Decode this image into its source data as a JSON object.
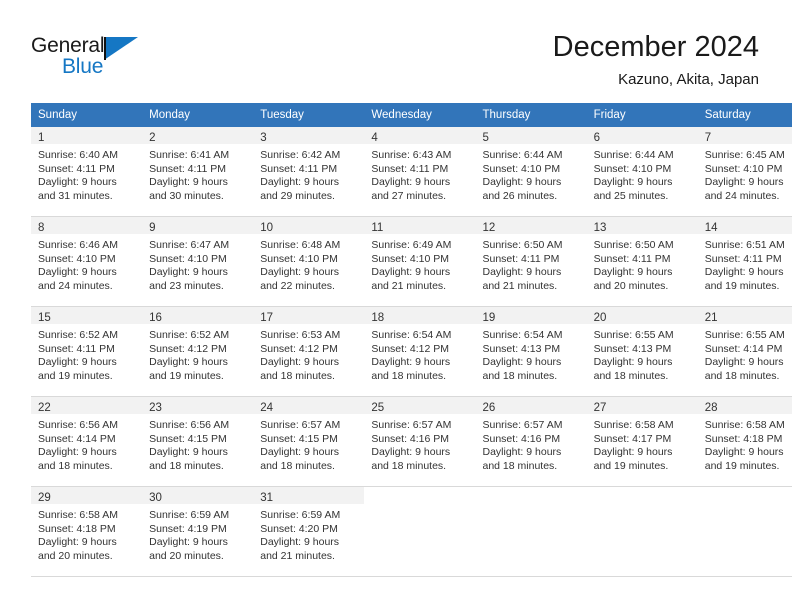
{
  "brand": {
    "word1": "General",
    "word2": "Blue",
    "triangle_color": "#1577c4",
    "text_color": "#1a1a1a"
  },
  "header": {
    "title": "December 2024",
    "subtitle": "Kazuno, Akita, Japan"
  },
  "colors": {
    "header_row_bg": "#3275ba",
    "header_row_text": "#ffffff",
    "daynum_shaded_bg": "#f2f2f2",
    "cell_border": "#d9d9d9",
    "body_text": "#333333"
  },
  "weekday_headers": [
    "Sunday",
    "Monday",
    "Tuesday",
    "Wednesday",
    "Thursday",
    "Friday",
    "Saturday"
  ],
  "weeks": [
    [
      {
        "day": "1",
        "sunrise": "Sunrise: 6:40 AM",
        "sunset": "Sunset: 4:11 PM",
        "daylight1": "Daylight: 9 hours",
        "daylight2": "and 31 minutes."
      },
      {
        "day": "2",
        "sunrise": "Sunrise: 6:41 AM",
        "sunset": "Sunset: 4:11 PM",
        "daylight1": "Daylight: 9 hours",
        "daylight2": "and 30 minutes."
      },
      {
        "day": "3",
        "sunrise": "Sunrise: 6:42 AM",
        "sunset": "Sunset: 4:11 PM",
        "daylight1": "Daylight: 9 hours",
        "daylight2": "and 29 minutes."
      },
      {
        "day": "4",
        "sunrise": "Sunrise: 6:43 AM",
        "sunset": "Sunset: 4:11 PM",
        "daylight1": "Daylight: 9 hours",
        "daylight2": "and 27 minutes."
      },
      {
        "day": "5",
        "sunrise": "Sunrise: 6:44 AM",
        "sunset": "Sunset: 4:10 PM",
        "daylight1": "Daylight: 9 hours",
        "daylight2": "and 26 minutes."
      },
      {
        "day": "6",
        "sunrise": "Sunrise: 6:44 AM",
        "sunset": "Sunset: 4:10 PM",
        "daylight1": "Daylight: 9 hours",
        "daylight2": "and 25 minutes."
      },
      {
        "day": "7",
        "sunrise": "Sunrise: 6:45 AM",
        "sunset": "Sunset: 4:10 PM",
        "daylight1": "Daylight: 9 hours",
        "daylight2": "and 24 minutes."
      }
    ],
    [
      {
        "day": "8",
        "sunrise": "Sunrise: 6:46 AM",
        "sunset": "Sunset: 4:10 PM",
        "daylight1": "Daylight: 9 hours",
        "daylight2": "and 24 minutes."
      },
      {
        "day": "9",
        "sunrise": "Sunrise: 6:47 AM",
        "sunset": "Sunset: 4:10 PM",
        "daylight1": "Daylight: 9 hours",
        "daylight2": "and 23 minutes."
      },
      {
        "day": "10",
        "sunrise": "Sunrise: 6:48 AM",
        "sunset": "Sunset: 4:10 PM",
        "daylight1": "Daylight: 9 hours",
        "daylight2": "and 22 minutes."
      },
      {
        "day": "11",
        "sunrise": "Sunrise: 6:49 AM",
        "sunset": "Sunset: 4:10 PM",
        "daylight1": "Daylight: 9 hours",
        "daylight2": "and 21 minutes."
      },
      {
        "day": "12",
        "sunrise": "Sunrise: 6:50 AM",
        "sunset": "Sunset: 4:11 PM",
        "daylight1": "Daylight: 9 hours",
        "daylight2": "and 21 minutes."
      },
      {
        "day": "13",
        "sunrise": "Sunrise: 6:50 AM",
        "sunset": "Sunset: 4:11 PM",
        "daylight1": "Daylight: 9 hours",
        "daylight2": "and 20 minutes."
      },
      {
        "day": "14",
        "sunrise": "Sunrise: 6:51 AM",
        "sunset": "Sunset: 4:11 PM",
        "daylight1": "Daylight: 9 hours",
        "daylight2": "and 19 minutes."
      }
    ],
    [
      {
        "day": "15",
        "sunrise": "Sunrise: 6:52 AM",
        "sunset": "Sunset: 4:11 PM",
        "daylight1": "Daylight: 9 hours",
        "daylight2": "and 19 minutes."
      },
      {
        "day": "16",
        "sunrise": "Sunrise: 6:52 AM",
        "sunset": "Sunset: 4:12 PM",
        "daylight1": "Daylight: 9 hours",
        "daylight2": "and 19 minutes."
      },
      {
        "day": "17",
        "sunrise": "Sunrise: 6:53 AM",
        "sunset": "Sunset: 4:12 PM",
        "daylight1": "Daylight: 9 hours",
        "daylight2": "and 18 minutes."
      },
      {
        "day": "18",
        "sunrise": "Sunrise: 6:54 AM",
        "sunset": "Sunset: 4:12 PM",
        "daylight1": "Daylight: 9 hours",
        "daylight2": "and 18 minutes."
      },
      {
        "day": "19",
        "sunrise": "Sunrise: 6:54 AM",
        "sunset": "Sunset: 4:13 PM",
        "daylight1": "Daylight: 9 hours",
        "daylight2": "and 18 minutes."
      },
      {
        "day": "20",
        "sunrise": "Sunrise: 6:55 AM",
        "sunset": "Sunset: 4:13 PM",
        "daylight1": "Daylight: 9 hours",
        "daylight2": "and 18 minutes."
      },
      {
        "day": "21",
        "sunrise": "Sunrise: 6:55 AM",
        "sunset": "Sunset: 4:14 PM",
        "daylight1": "Daylight: 9 hours",
        "daylight2": "and 18 minutes."
      }
    ],
    [
      {
        "day": "22",
        "sunrise": "Sunrise: 6:56 AM",
        "sunset": "Sunset: 4:14 PM",
        "daylight1": "Daylight: 9 hours",
        "daylight2": "and 18 minutes."
      },
      {
        "day": "23",
        "sunrise": "Sunrise: 6:56 AM",
        "sunset": "Sunset: 4:15 PM",
        "daylight1": "Daylight: 9 hours",
        "daylight2": "and 18 minutes."
      },
      {
        "day": "24",
        "sunrise": "Sunrise: 6:57 AM",
        "sunset": "Sunset: 4:15 PM",
        "daylight1": "Daylight: 9 hours",
        "daylight2": "and 18 minutes."
      },
      {
        "day": "25",
        "sunrise": "Sunrise: 6:57 AM",
        "sunset": "Sunset: 4:16 PM",
        "daylight1": "Daylight: 9 hours",
        "daylight2": "and 18 minutes."
      },
      {
        "day": "26",
        "sunrise": "Sunrise: 6:57 AM",
        "sunset": "Sunset: 4:16 PM",
        "daylight1": "Daylight: 9 hours",
        "daylight2": "and 18 minutes."
      },
      {
        "day": "27",
        "sunrise": "Sunrise: 6:58 AM",
        "sunset": "Sunset: 4:17 PM",
        "daylight1": "Daylight: 9 hours",
        "daylight2": "and 19 minutes."
      },
      {
        "day": "28",
        "sunrise": "Sunrise: 6:58 AM",
        "sunset": "Sunset: 4:18 PM",
        "daylight1": "Daylight: 9 hours",
        "daylight2": "and 19 minutes."
      }
    ],
    [
      {
        "day": "29",
        "sunrise": "Sunrise: 6:58 AM",
        "sunset": "Sunset: 4:18 PM",
        "daylight1": "Daylight: 9 hours",
        "daylight2": "and 20 minutes."
      },
      {
        "day": "30",
        "sunrise": "Sunrise: 6:59 AM",
        "sunset": "Sunset: 4:19 PM",
        "daylight1": "Daylight: 9 hours",
        "daylight2": "and 20 minutes."
      },
      {
        "day": "31",
        "sunrise": "Sunrise: 6:59 AM",
        "sunset": "Sunset: 4:20 PM",
        "daylight1": "Daylight: 9 hours",
        "daylight2": "and 21 minutes."
      },
      {
        "day": "",
        "sunrise": "",
        "sunset": "",
        "daylight1": "",
        "daylight2": ""
      },
      {
        "day": "",
        "sunrise": "",
        "sunset": "",
        "daylight1": "",
        "daylight2": ""
      },
      {
        "day": "",
        "sunrise": "",
        "sunset": "",
        "daylight1": "",
        "daylight2": ""
      },
      {
        "day": "",
        "sunrise": "",
        "sunset": "",
        "daylight1": "",
        "daylight2": ""
      }
    ]
  ]
}
